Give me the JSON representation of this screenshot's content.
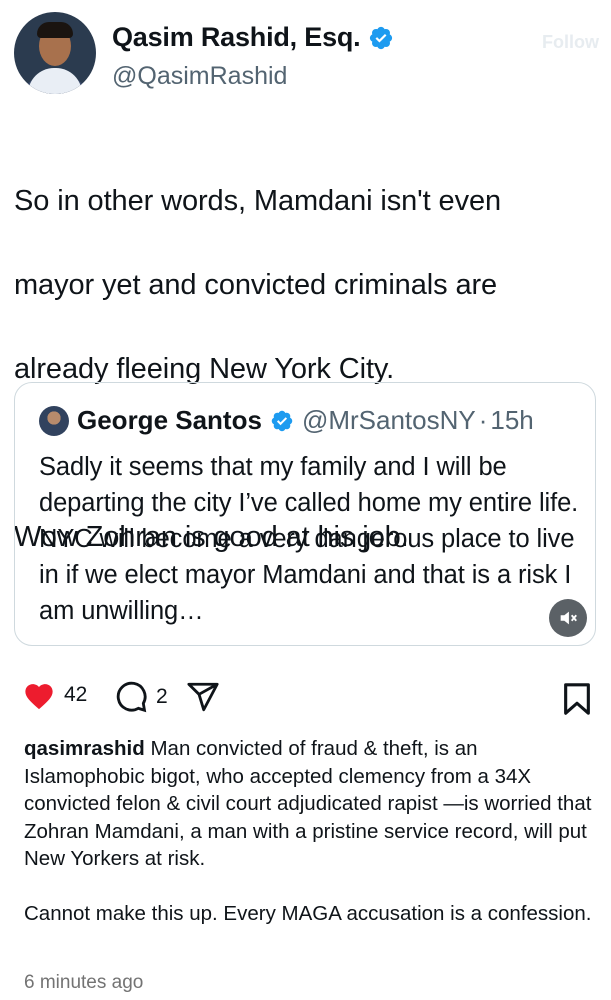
{
  "tweet": {
    "author_name": "Qasim Rashid, Esq.",
    "author_handle": "@QasimRashid",
    "follow_hint": "Follow",
    "text_lines": [
      "So in other words, Mamdani isn't even",
      "mayor yet and convicted criminals are",
      "already fleeing New York City."
    ],
    "text_line_2": "Wow Zohran is good at his job."
  },
  "quoted_tweet": {
    "author_name": "George Santos",
    "author_handle": "@MrSantosNY",
    "separator": "·",
    "time": "15h",
    "text": "Sadly it seems that my family and I will be departing the city I’ve called home my entire life. NYC will become a very dangerous place to live in if we elect mayor Mamdani and that is a risk I am unwilling…"
  },
  "actions": {
    "like_count": "42",
    "comment_count": "2"
  },
  "caption": {
    "username": "qasimrashid",
    "body": "Man convicted of fraud & theft, is an Islamophobic bigot, who accepted clemency from a 34X convicted felon & civil court adjudicated rapist —is worried that Zohran Mamdani, a man with a pristine service record, will put New Yorkers at risk.",
    "body2": "Cannot make this up. Every MAGA accusation is a confession."
  },
  "timestamp": "6 minutes ago",
  "icons": {
    "verified": "verified-badge-icon",
    "like": "heart-icon",
    "comment": "comment-icon",
    "share": "send-icon",
    "bookmark": "bookmark-icon",
    "mute": "speaker-muted-icon"
  },
  "colors": {
    "verified_blue": "#1d9bf0",
    "like_red": "#ed1c2e",
    "secondary_text": "#536471"
  }
}
